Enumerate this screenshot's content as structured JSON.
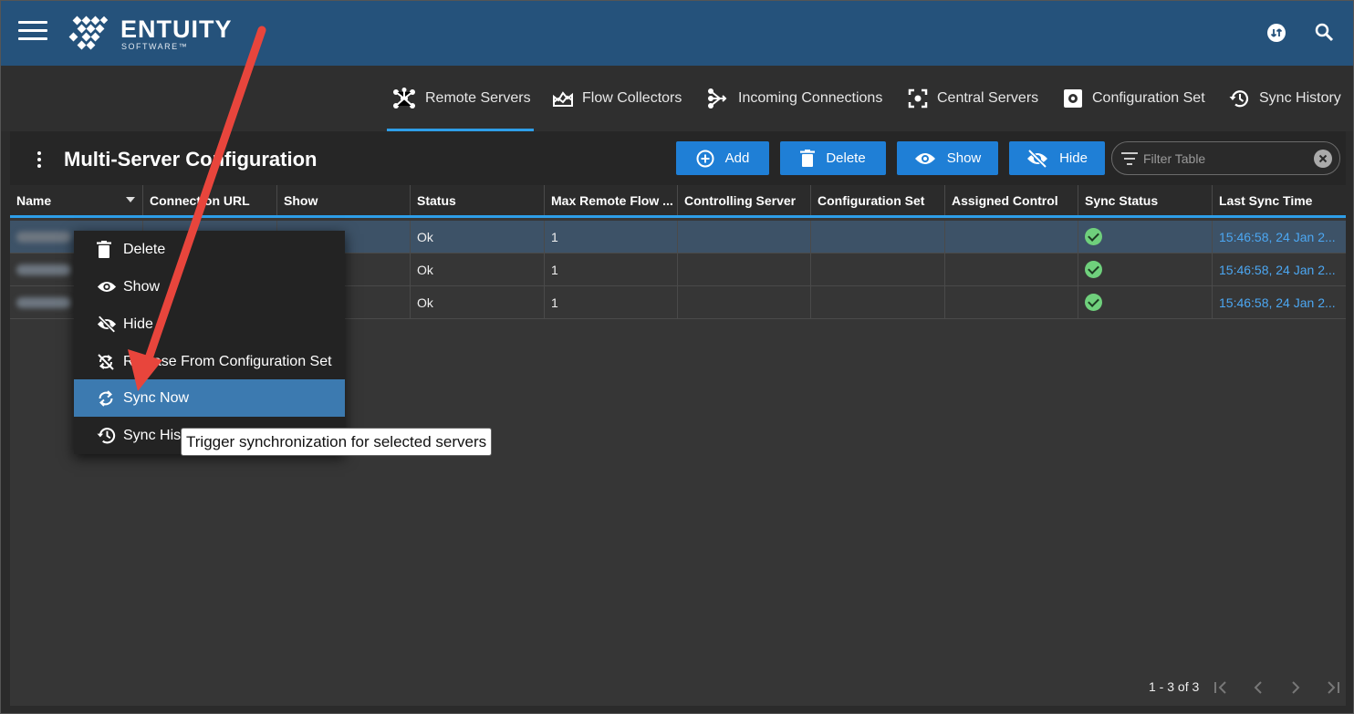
{
  "brand": {
    "name": "ENTUITY",
    "sub": "SOFTWARE™"
  },
  "header": {
    "icons": [
      "menu-icon",
      "sync-status-icon",
      "search-icon"
    ]
  },
  "tabs": [
    {
      "label": "Remote Servers",
      "icon": "hub-icon",
      "active": true
    },
    {
      "label": "Flow Collectors",
      "icon": "chart-area-icon"
    },
    {
      "label": "Incoming Connections",
      "icon": "incoming-icon"
    },
    {
      "label": "Central Servers",
      "icon": "center-focus-icon"
    },
    {
      "label": "Configuration Set",
      "icon": "settings-box-icon"
    },
    {
      "label": "Sync History",
      "icon": "history-icon"
    }
  ],
  "panel": {
    "title": "Multi-Server Configuration",
    "buttons": {
      "add": "Add",
      "delete": "Delete",
      "show": "Show",
      "hide": "Hide"
    },
    "filter_placeholder": "Filter Table"
  },
  "table": {
    "columns": [
      "Name",
      "Connection URL",
      "Show",
      "Status",
      "Max Remote Flow ...",
      "Controlling Server",
      "Configuration Set",
      "Assigned Control",
      "Sync Status",
      "Last Sync Time"
    ],
    "rows": [
      {
        "status": "Ok",
        "max_flow": "1",
        "sync": "ok",
        "last_sync": "15:46:58, 24 Jan 2..."
      },
      {
        "status": "Ok",
        "max_flow": "1",
        "sync": "ok",
        "last_sync": "15:46:58, 24 Jan 2..."
      },
      {
        "status": "Ok",
        "max_flow": "1",
        "sync": "ok",
        "last_sync": "15:46:58, 24 Jan 2..."
      }
    ]
  },
  "pager": {
    "text": "1 - 3 of 3"
  },
  "context_menu": {
    "items": [
      {
        "label": "Delete",
        "icon": "trash-icon"
      },
      {
        "label": "Show",
        "icon": "eye-icon"
      },
      {
        "label": "Hide",
        "icon": "eye-off-icon"
      },
      {
        "label": "Release From Configuration Set",
        "icon": "sync-off-icon"
      },
      {
        "label": "Sync Now",
        "icon": "sync-icon",
        "highlighted": true
      },
      {
        "label": "Sync History",
        "icon": "history-icon"
      }
    ]
  },
  "tooltip": "Trigger synchronization for selected servers",
  "colors": {
    "header": "#25527b",
    "accent": "#2e9ee8",
    "button": "#1f7fd6",
    "highlight": "#3c7ab0",
    "arrow": "#e8453c"
  }
}
